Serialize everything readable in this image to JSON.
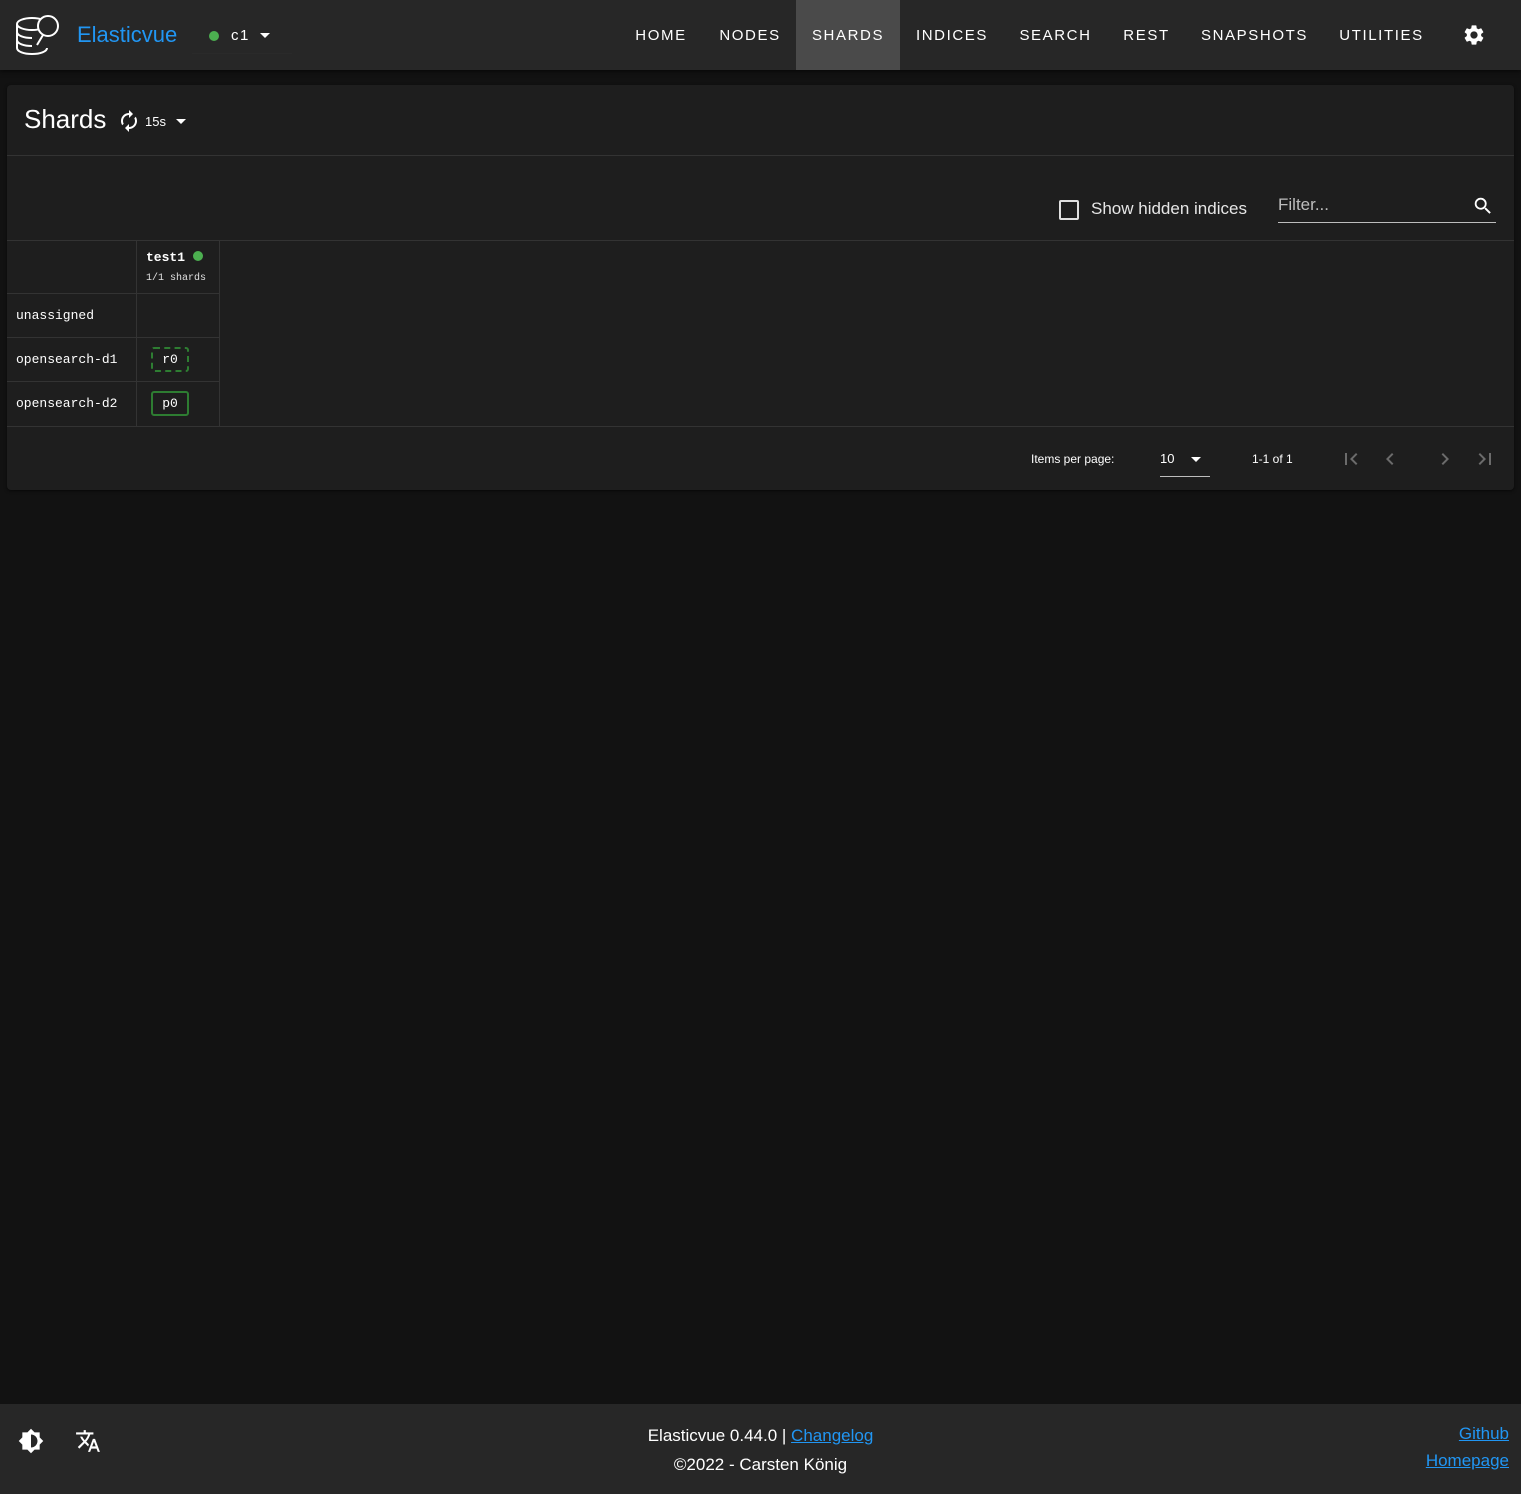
{
  "app": {
    "brand": "Elasticvue",
    "cluster_name": "c1",
    "status_color": "#4caf50",
    "accent_color": "#2196f3"
  },
  "nav": {
    "items": [
      "HOME",
      "NODES",
      "SHARDS",
      "INDICES",
      "SEARCH",
      "REST",
      "SNAPSHOTS",
      "UTILITIES"
    ],
    "active": "SHARDS"
  },
  "page": {
    "title": "Shards",
    "refresh_interval": "15s",
    "show_hidden_label": "Show hidden indices",
    "show_hidden_checked": false,
    "filter_placeholder": "Filter...",
    "filter_value": ""
  },
  "table": {
    "index": {
      "name": "test1",
      "health": "green",
      "shards_text": "1/1 shards"
    },
    "rows": [
      {
        "node": "unassigned",
        "shard": ""
      },
      {
        "node": "opensearch-d1",
        "shard": "r0"
      },
      {
        "node": "opensearch-d2",
        "shard": "p0"
      }
    ]
  },
  "pagination": {
    "items_per_page_label": "Items per page:",
    "items_per_page": "10",
    "range": "1-1 of 1"
  },
  "footer": {
    "version_text": "Elasticvue 0.44.0 |",
    "changelog": "Changelog",
    "copyright": "©2022 - Carsten König",
    "github": "Github",
    "homepage": "Homepage"
  },
  "icons": [
    "logo-icon",
    "chevron-down-icon",
    "gear-icon",
    "refresh-icon",
    "search-icon",
    "first-page-icon",
    "prev-page-icon",
    "next-page-icon",
    "last-page-icon",
    "theme-toggle-icon",
    "translate-icon"
  ]
}
